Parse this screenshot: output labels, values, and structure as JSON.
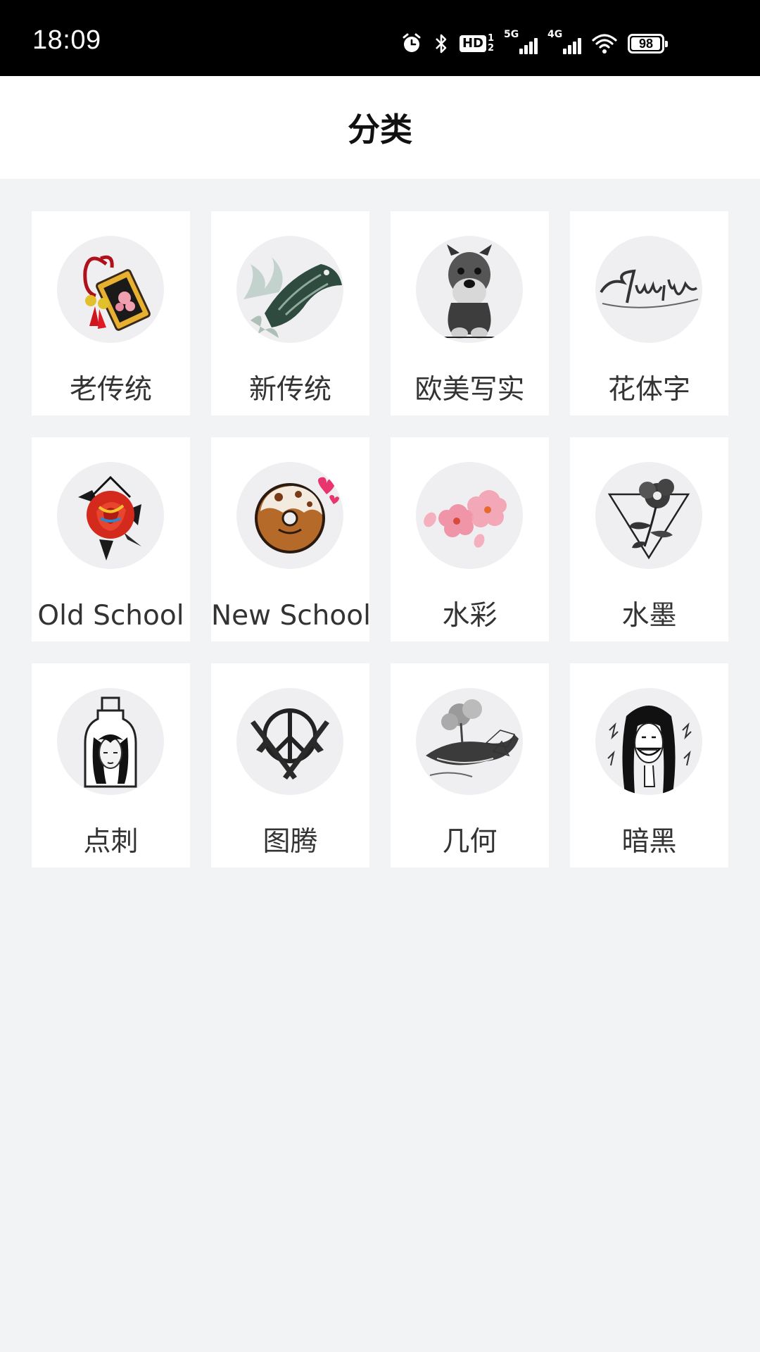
{
  "status_bar": {
    "time": "18:09",
    "icons": [
      "alarm-icon",
      "bluetooth-icon",
      "hd-call-icon",
      "signal-5g-icon",
      "signal-4g-icon",
      "wifi-icon",
      "battery-icon"
    ],
    "hd_label": "HD",
    "hd_sims": [
      "1",
      "2"
    ],
    "sig1_label": "5G",
    "sig2_label": "4G",
    "battery_level": "98",
    "battery_fraction": 0.98
  },
  "header": {
    "title": "分类"
  },
  "categories": [
    {
      "label": "老传统",
      "icon": "omamori-charm-icon"
    },
    {
      "label": "新传统",
      "icon": "koi-fish-icon"
    },
    {
      "label": "欧美写实",
      "icon": "schnauzer-dog-icon"
    },
    {
      "label": "花体字",
      "icon": "script-lettering-icon"
    },
    {
      "label": "Old School",
      "icon": "rose-icon"
    },
    {
      "label": "New School",
      "icon": "donut-icon"
    },
    {
      "label": "水彩",
      "icon": "cherry-blossom-icon"
    },
    {
      "label": "水墨",
      "icon": "ink-flower-triangle-icon"
    },
    {
      "label": "点刺",
      "icon": "girl-in-bottle-icon"
    },
    {
      "label": "图腾",
      "icon": "peace-rifles-icon"
    },
    {
      "label": "几何",
      "icon": "geometric-whale-icon"
    },
    {
      "label": "暗黑",
      "icon": "dark-smile-girl-icon"
    }
  ],
  "colors": {
    "status_bar_bg": "#000000",
    "header_bg": "#ffffff",
    "page_bg": "#f2f3f5",
    "card_bg": "#ffffff",
    "thumb_bg": "#efeff1",
    "label_text": "#333333"
  }
}
